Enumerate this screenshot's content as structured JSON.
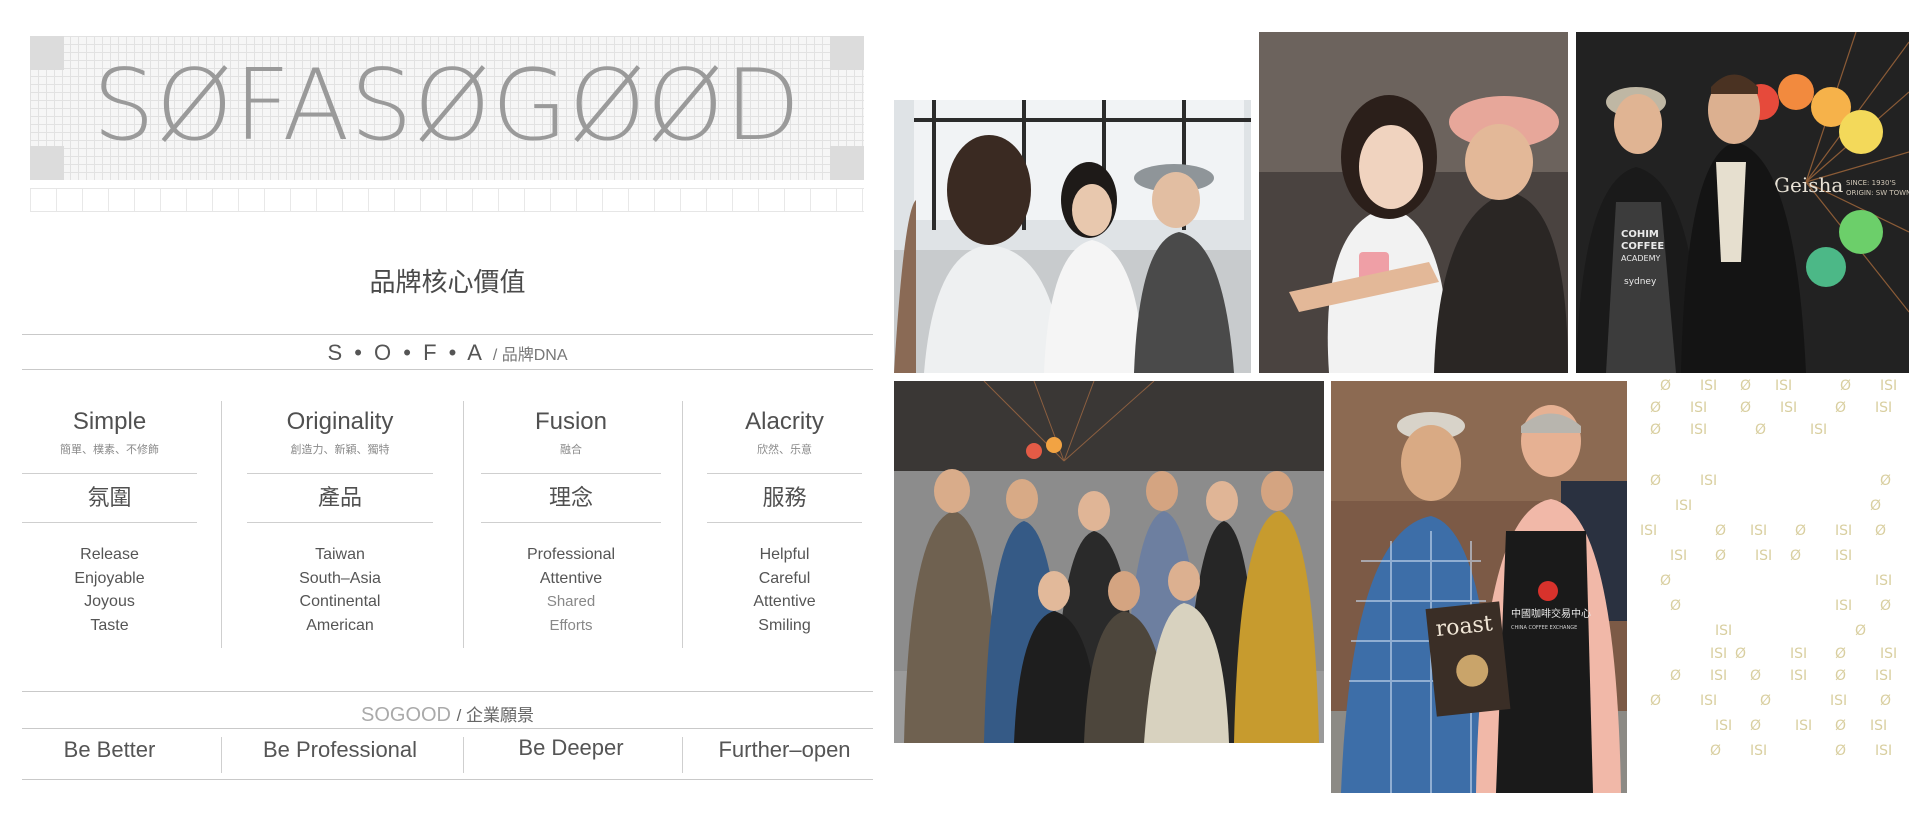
{
  "logo": {
    "wordmark": "SØFASØGØØD"
  },
  "core_values_title": "品牌核心價值",
  "dna": {
    "letters": "S • O • F • A",
    "suffix": "/ 品牌DNA"
  },
  "columns": [
    {
      "title": "Simple",
      "subtitle": "簡單、樸素、不修飾",
      "category": "氛圍",
      "items": [
        "Release",
        "Enjoyable",
        "Joyous",
        "Taste"
      ]
    },
    {
      "title": "Originality",
      "subtitle": "創造力、新穎、獨特",
      "category": "產品",
      "items": [
        "Taiwan",
        "South–Asia",
        "Continental",
        "American"
      ]
    },
    {
      "title": "Fusion",
      "subtitle": "融合",
      "category": "理念",
      "items": [
        "Professional",
        "Attentive",
        "Shared",
        "Efforts"
      ]
    },
    {
      "title": "Alacrity",
      "subtitle": "欣然、乐意",
      "category": "服務",
      "items": [
        "Helpful",
        "Careful",
        "Attentive",
        "Smiling"
      ]
    }
  ],
  "vision": {
    "brand": "SOGOOD",
    "suffix": "/ 企業願景",
    "items": [
      "Be Better",
      "Be Professional",
      "Be Deeper",
      "Further–open"
    ]
  },
  "photo_texts": {
    "poster_brand": "Geisha",
    "poster_since": "SINCE: 1930'S",
    "poster_origin": "ORIGIN: SW TOWN OF",
    "apron_line1": "COHIM",
    "apron_line2": "COFFEE",
    "apron_line3": "ACADEMY",
    "apron_line4": "sydney",
    "book_title": "roast",
    "apron_cn": "中國咖啡交易中心",
    "apron_cn_sub": "CHINA COFFEE EXCHANGE"
  },
  "pattern_glyphs": [
    "Ø",
    "ISI"
  ],
  "colors": {
    "text": "#444444",
    "rule": "#c9c9c9",
    "pattern": "#d9cfa0",
    "cap_pink": "#e7a79a"
  }
}
